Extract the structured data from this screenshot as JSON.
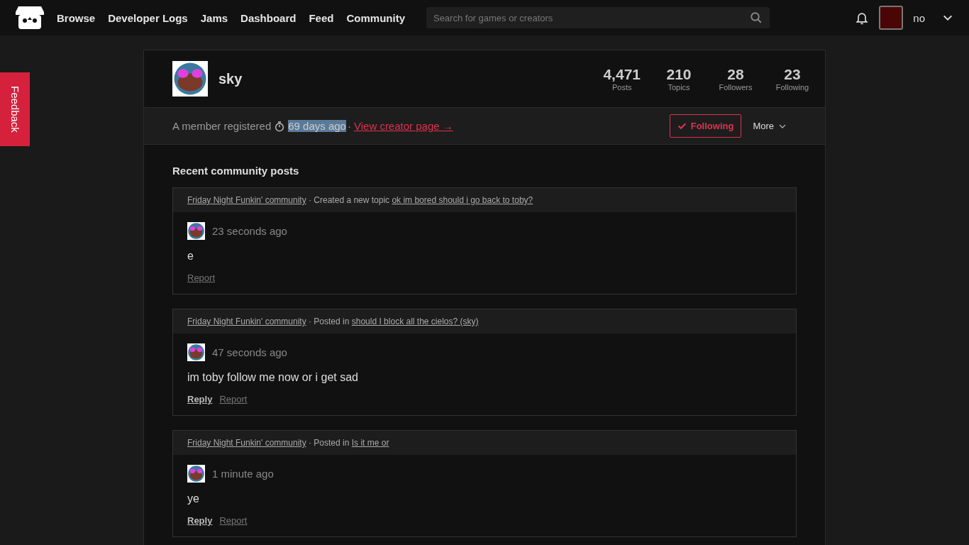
{
  "nav": {
    "links": [
      "Browse",
      "Developer Logs",
      "Jams",
      "Dashboard",
      "Feed",
      "Community"
    ],
    "search": {
      "placeholder": "Search for games or creators"
    },
    "user": {
      "name": "no"
    }
  },
  "feedback_tab": {
    "label": "Feedback"
  },
  "profile": {
    "name": "sky",
    "stats": [
      {
        "value": "4,471",
        "label": "Posts"
      },
      {
        "value": "210",
        "label": "Topics"
      },
      {
        "value": "28",
        "label": "Followers"
      },
      {
        "value": "23",
        "label": "Following"
      }
    ],
    "registered_prefix": "A member registered",
    "registered_ago": "69 days ago",
    "registered_ago_highlighted": true,
    "separator": "·",
    "creator_link": "View creator page →",
    "follow_button": {
      "label": "Following",
      "on": true
    },
    "more_button": "More"
  },
  "recent": {
    "title": "Recent community posts",
    "posts": [
      {
        "community": "Friday Night Funkin' community",
        "action": "· Created a new topic",
        "topic": "ok im bored should i go back to toby?",
        "time": "23 seconds ago",
        "body": "e",
        "actions": [
          {
            "kind": "report",
            "label": "Report"
          }
        ]
      },
      {
        "community": "Friday Night Funkin' community",
        "action": "· Posted in",
        "topic": "should I block all the cielos? (sky)",
        "time": "47 seconds ago",
        "body": "im toby follow me now or i get sad",
        "actions": [
          {
            "kind": "reply",
            "label": "Reply"
          },
          {
            "kind": "report",
            "label": "Report"
          }
        ]
      },
      {
        "community": "Friday Night Funkin' community",
        "action": "· Posted in",
        "topic": "Is it me or",
        "time": "1 minute ago",
        "body": "ye",
        "actions": [
          {
            "kind": "reply",
            "label": "Reply"
          },
          {
            "kind": "report",
            "label": "Report"
          }
        ]
      }
    ]
  }
}
